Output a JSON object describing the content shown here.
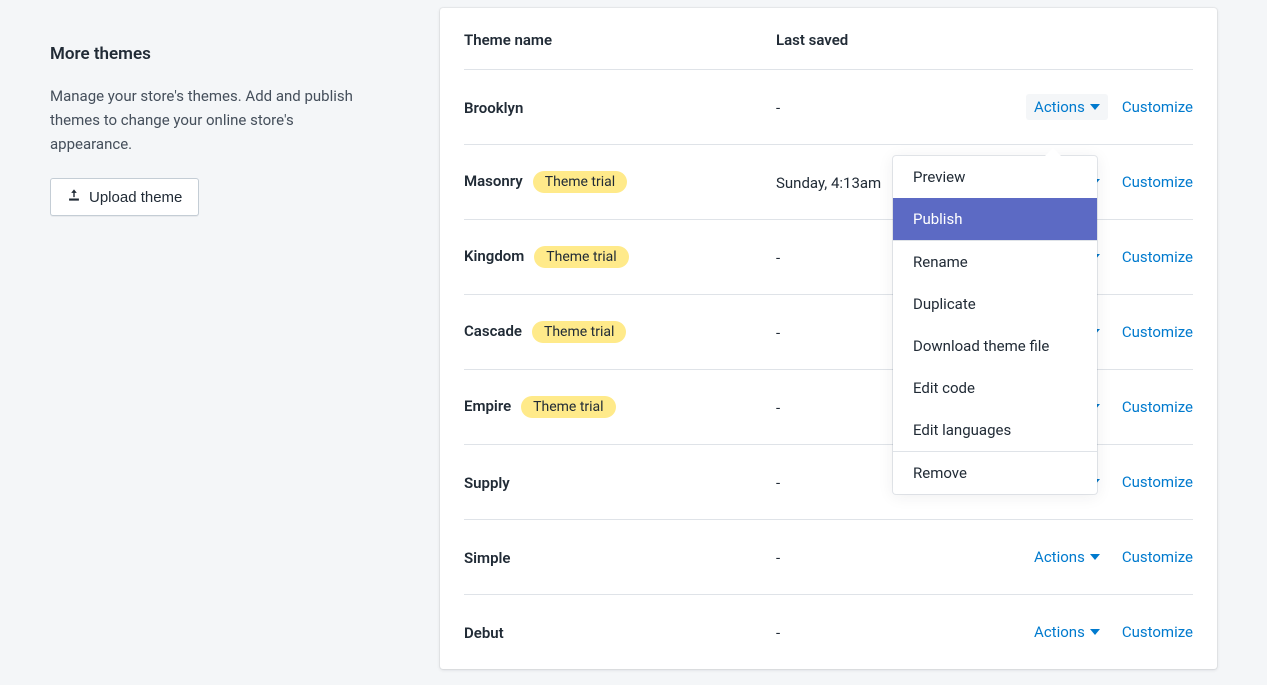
{
  "sidebar": {
    "title": "More themes",
    "description": "Manage your store's themes. Add and publish themes to change your online store's appearance.",
    "upload_label": "Upload theme"
  },
  "table": {
    "header_name": "Theme name",
    "header_saved": "Last saved",
    "actions_label": "Actions",
    "customize_label": "Customize",
    "trial_badge": "Theme trial"
  },
  "themes": [
    {
      "name": "Brooklyn",
      "trial": false,
      "saved": "-"
    },
    {
      "name": "Masonry",
      "trial": true,
      "saved": "Sunday, 4:13am"
    },
    {
      "name": "Kingdom",
      "trial": true,
      "saved": "-"
    },
    {
      "name": "Cascade",
      "trial": true,
      "saved": "-"
    },
    {
      "name": "Empire",
      "trial": true,
      "saved": "-"
    },
    {
      "name": "Supply",
      "trial": false,
      "saved": "-"
    },
    {
      "name": "Simple",
      "trial": false,
      "saved": "-"
    },
    {
      "name": "Debut",
      "trial": false,
      "saved": "-"
    }
  ],
  "dropdown": {
    "groups": [
      [
        "Preview",
        "Publish"
      ],
      [
        "Rename",
        "Duplicate",
        "Download theme file",
        "Edit code",
        "Edit languages"
      ],
      [
        "Remove"
      ]
    ],
    "highlighted": "Publish"
  },
  "colors": {
    "link": "#007ace",
    "highlight": "#5c6ac4",
    "badge_bg": "#ffea8a"
  }
}
